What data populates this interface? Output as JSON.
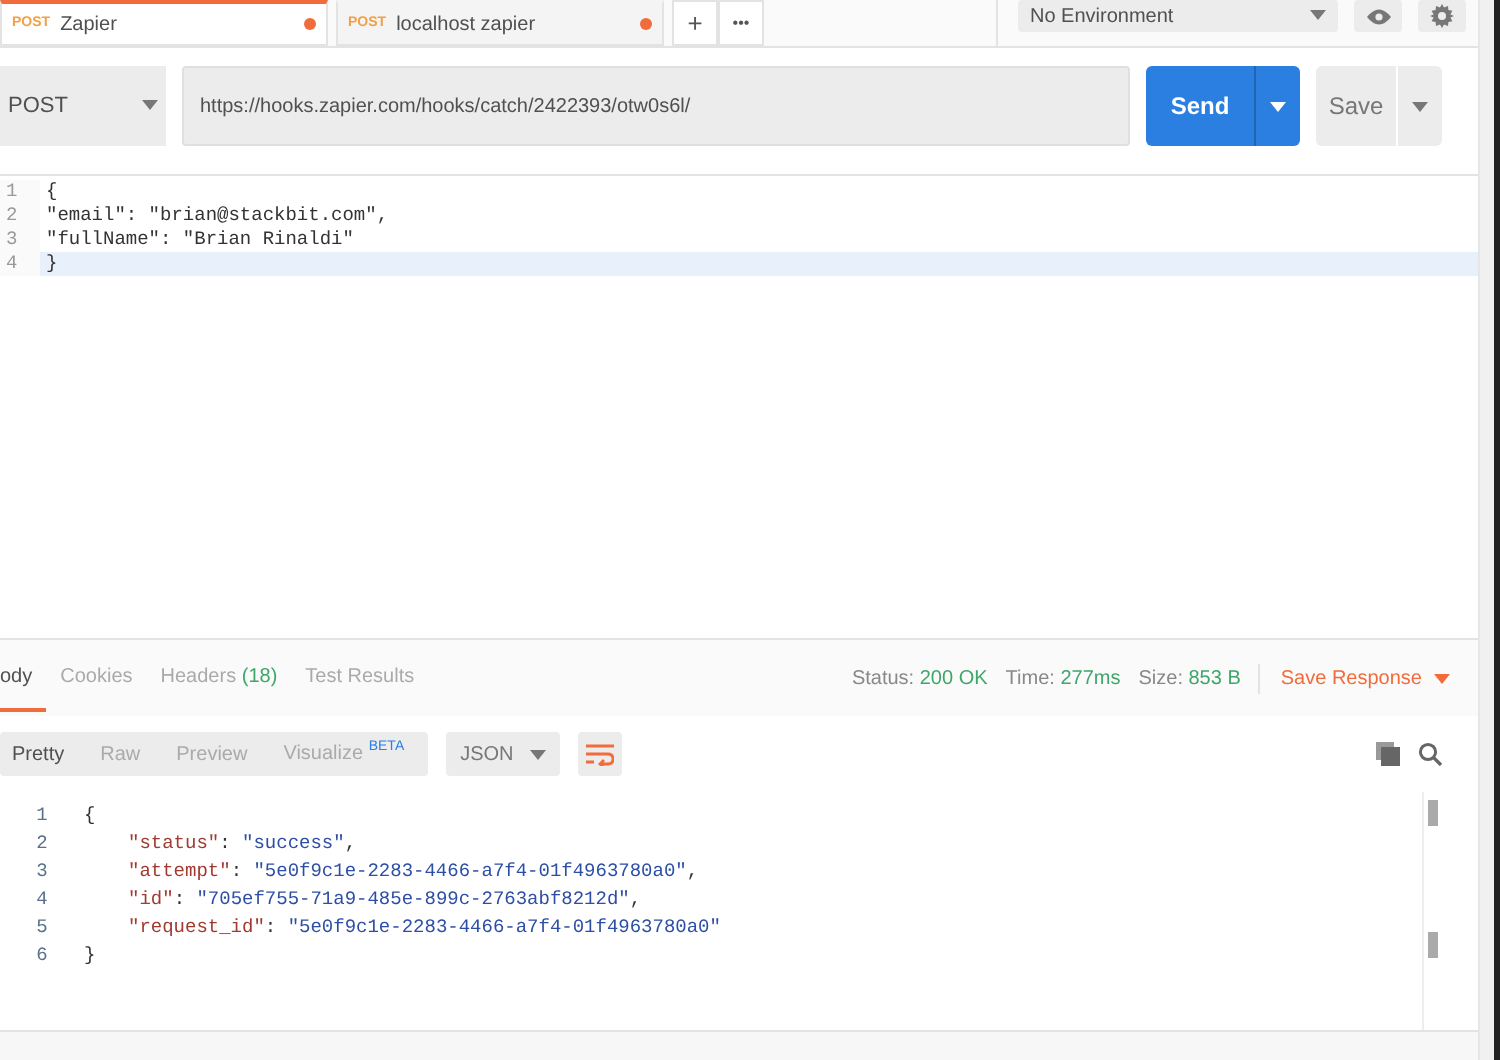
{
  "tabs": [
    {
      "method": "POST",
      "label": "Zapier",
      "selected": true,
      "unsaved": true
    },
    {
      "method": "POST",
      "label": "localhost zapier",
      "selected": false,
      "unsaved": true
    }
  ],
  "tab_actions": {
    "new": "+",
    "more": "•••"
  },
  "environment": "No Environment",
  "request": {
    "method": "POST",
    "url": "https://hooks.zapier.com/hooks/catch/2422393/otw0s6l/",
    "send": "Send",
    "save": "Save"
  },
  "body_editor": {
    "lines": [
      {
        "number": "1",
        "text": "{",
        "highlighted": false
      },
      {
        "number": "2",
        "text": "\"email\": \"brian@stackbit.com\",",
        "highlighted": false
      },
      {
        "number": "3",
        "text": "\"fullName\": \"Brian Rinaldi\"",
        "highlighted": false
      },
      {
        "number": "4",
        "text": "}",
        "highlighted": true
      }
    ]
  },
  "response": {
    "tabs": [
      {
        "label": "ody",
        "selected": true
      },
      {
        "label": "Cookies",
        "selected": false
      },
      {
        "label": "Headers",
        "count": "(18)",
        "selected": false
      },
      {
        "label": "Test Results",
        "selected": false
      }
    ],
    "stats": [
      {
        "label": "Status:",
        "value": "200 OK"
      },
      {
        "label": "Time:",
        "value": "277ms"
      },
      {
        "label": "Size:",
        "value": "853 B"
      }
    ],
    "save_response": "Save Response",
    "view_modes": [
      {
        "label": "Pretty",
        "selected": true
      },
      {
        "label": "Raw",
        "selected": false
      },
      {
        "label": "Preview",
        "selected": false
      },
      {
        "label": "Visualize",
        "badge": "BETA",
        "selected": false
      }
    ],
    "format": "JSON",
    "lines": [
      {
        "number": "1",
        "indented": false,
        "tokens": [
          {
            "kind": "punct",
            "text": "{"
          }
        ]
      },
      {
        "number": "2",
        "indented": true,
        "tokens": [
          {
            "kind": "key",
            "text": "\"status\""
          },
          {
            "kind": "punct",
            "text": ": "
          },
          {
            "kind": "string",
            "text": "\"success\""
          },
          {
            "kind": "punct",
            "text": ","
          }
        ]
      },
      {
        "number": "3",
        "indented": true,
        "tokens": [
          {
            "kind": "key",
            "text": "\"attempt\""
          },
          {
            "kind": "punct",
            "text": ": "
          },
          {
            "kind": "string",
            "text": "\"5e0f9c1e-2283-4466-a7f4-01f4963780a0\""
          },
          {
            "kind": "punct",
            "text": ","
          }
        ]
      },
      {
        "number": "4",
        "indented": true,
        "tokens": [
          {
            "kind": "key",
            "text": "\"id\""
          },
          {
            "kind": "punct",
            "text": ": "
          },
          {
            "kind": "string",
            "text": "\"705ef755-71a9-485e-899c-2763abf8212d\""
          },
          {
            "kind": "punct",
            "text": ","
          }
        ]
      },
      {
        "number": "5",
        "indented": true,
        "tokens": [
          {
            "kind": "key",
            "text": "\"request_id\""
          },
          {
            "kind": "punct",
            "text": ": "
          },
          {
            "kind": "string",
            "text": "\"5e0f9c1e-2283-4466-a7f4-01f4963780a0\""
          }
        ]
      },
      {
        "number": "6",
        "indented": false,
        "tokens": [
          {
            "kind": "punct",
            "text": "}"
          }
        ]
      }
    ]
  }
}
